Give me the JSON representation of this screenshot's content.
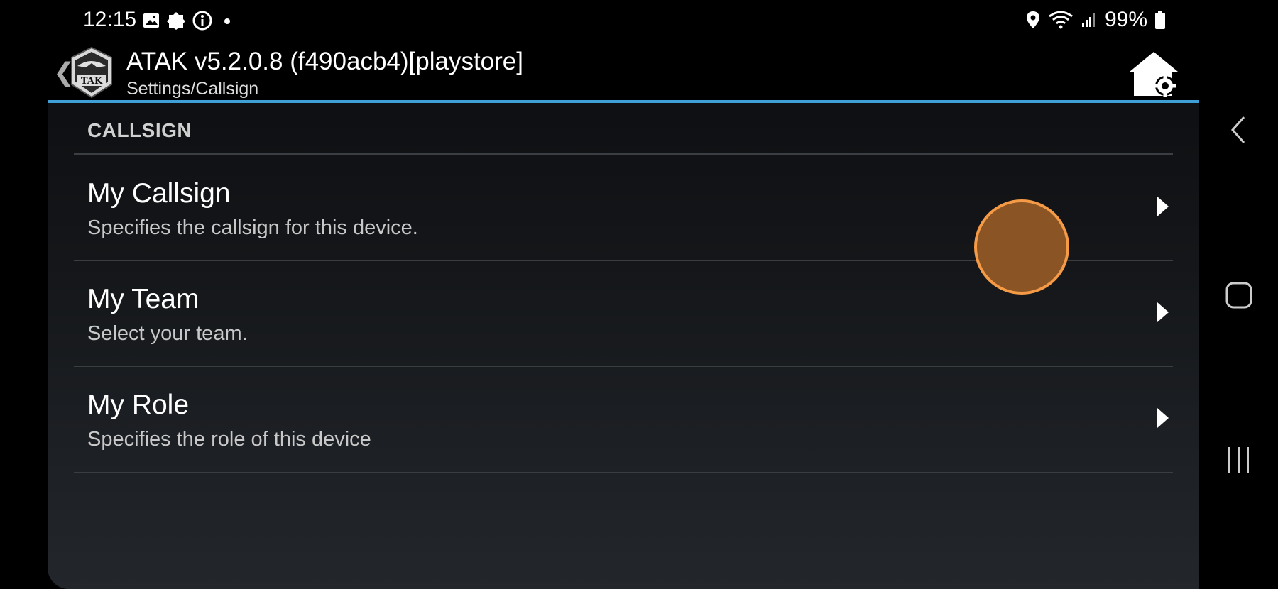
{
  "status_bar": {
    "time": "12:15",
    "battery_percent": "99%",
    "icons": [
      "image-icon",
      "notification-icon",
      "info-icon",
      "dot-icon",
      "location-icon",
      "wifi-icon",
      "signal-icon",
      "battery-icon"
    ]
  },
  "app_bar": {
    "title": "ATAK v5.2.0.8 (f490acb4)[playstore]",
    "subtitle": "Settings/Callsign",
    "logo_text": "TAK",
    "accent_color": "#3fa0d8"
  },
  "section": {
    "header": "CALLSIGN",
    "items": [
      {
        "title": "My Callsign",
        "summary": "Specifies the callsign for this device."
      },
      {
        "title": "My Team",
        "summary": "Select your team."
      },
      {
        "title": "My Role",
        "summary": "Specifies the role of this device"
      }
    ]
  },
  "touch_indicator": {
    "fill": "#8a5424",
    "stroke": "#f59a46"
  },
  "nav_bar": [
    "back-icon",
    "home-icon",
    "recents-icon"
  ]
}
